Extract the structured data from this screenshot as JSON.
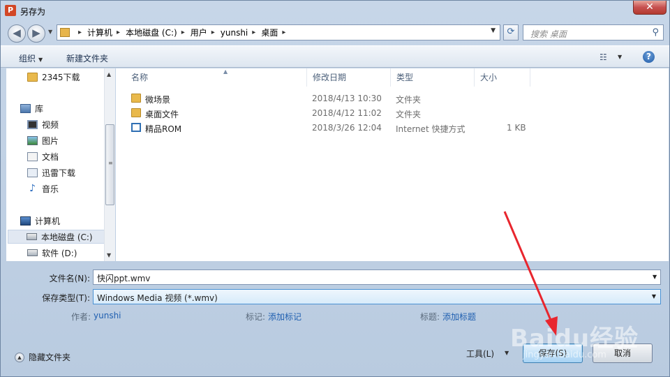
{
  "window": {
    "title": "另存为",
    "app_icon": "P",
    "close_label": "✕"
  },
  "address": {
    "crumbs": [
      "计算机",
      "本地磁盘 (C:)",
      "用户",
      "yunshi",
      "桌面"
    ],
    "search_placeholder": "搜索 桌面"
  },
  "toolbar": {
    "organize": "组织",
    "new_folder": "新建文件夹"
  },
  "sidebar": {
    "items": [
      {
        "label": "2345下载",
        "icon": "folder-icon"
      },
      {
        "label": "库",
        "icon": "library-icon"
      },
      {
        "label": "视频",
        "icon": "video-icon"
      },
      {
        "label": "图片",
        "icon": "picture-icon"
      },
      {
        "label": "文档",
        "icon": "document-icon"
      },
      {
        "label": "迅雷下载",
        "icon": "download-icon"
      },
      {
        "label": "音乐",
        "icon": "music-icon"
      },
      {
        "label": "计算机",
        "icon": "computer-icon"
      },
      {
        "label": "本地磁盘 (C:)",
        "icon": "drive-icon",
        "selected": true
      },
      {
        "label": "软件 (D:)",
        "icon": "drive-icon"
      }
    ]
  },
  "files": {
    "columns": [
      "名称",
      "修改日期",
      "类型",
      "大小"
    ],
    "rows": [
      {
        "name": "微场景",
        "date": "2018/4/13 10:30",
        "type": "文件夹",
        "size": "",
        "icon": "folder-icon"
      },
      {
        "name": "桌面文件",
        "date": "2018/4/12 11:02",
        "type": "文件夹",
        "size": "",
        "icon": "folder-icon"
      },
      {
        "name": "精品ROM",
        "date": "2018/3/26 12:04",
        "type": "Internet 快捷方式",
        "size": "1 KB",
        "icon": "shortcut-icon"
      }
    ]
  },
  "form": {
    "filename_label": "文件名(N):",
    "filename_value": "快闪ppt.wmv",
    "filetype_label": "保存类型(T):",
    "filetype_value": "Windows Media 视频 (*.wmv)",
    "author_label": "作者:",
    "author_value": "yunshi",
    "tags_label": "标记:",
    "tags_value": "添加标记",
    "title_label": "标题:",
    "title_value": "添加标题"
  },
  "footer": {
    "hide_folders": "隐藏文件夹",
    "tools": "工具(L)",
    "save": "保存(S)",
    "cancel": "取消"
  },
  "watermark": {
    "text": "Baidu经验",
    "sub": "jingyan.baidu.com"
  },
  "colors": {
    "annotation_arrow": "#e8262e",
    "accent": "#1f5fb0"
  }
}
